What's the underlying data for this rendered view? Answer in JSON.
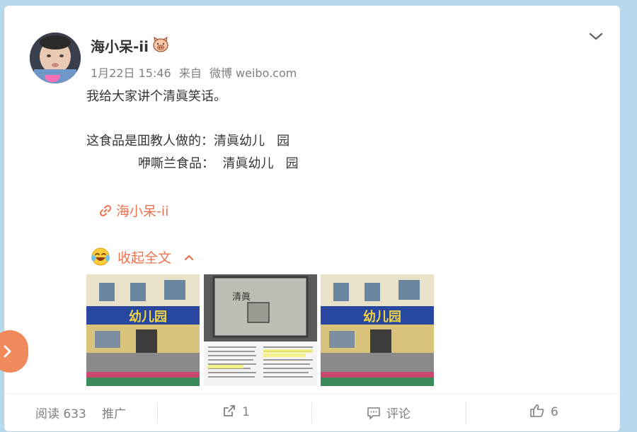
{
  "post": {
    "author": "海小呆-ii",
    "badge_icon": "pig-icon",
    "date": "1月22日 15:46",
    "source_prefix": "来自",
    "source": "微博 weibo.com",
    "lines": [
      "我给大家讲个清眞笑话。",
      "这食品是囬教人做的：清眞幼儿   园",
      "咿嘶兰食品：  清眞幼儿   园"
    ],
    "mention_link": "海小呆-ii",
    "collapse_label": "收起全文",
    "images": [
      {
        "kind": "kindergarten-photo",
        "sign_text": "幼儿园"
      },
      {
        "kind": "book-scan-photo",
        "stamp_text": "清眞"
      },
      {
        "kind": "kindergarten-photo",
        "sign_text": "幼儿园"
      }
    ]
  },
  "footer": {
    "read_label": "阅读",
    "read_count": "633",
    "promote_label": "推广",
    "repost_count": "1",
    "comment_label": "评论",
    "like_count": "6"
  },
  "colors": {
    "accent": "#eb7350",
    "text": "#333333",
    "muted": "#808080",
    "page_bg": "#b6d9ee",
    "side_button": "#f08a5d"
  }
}
